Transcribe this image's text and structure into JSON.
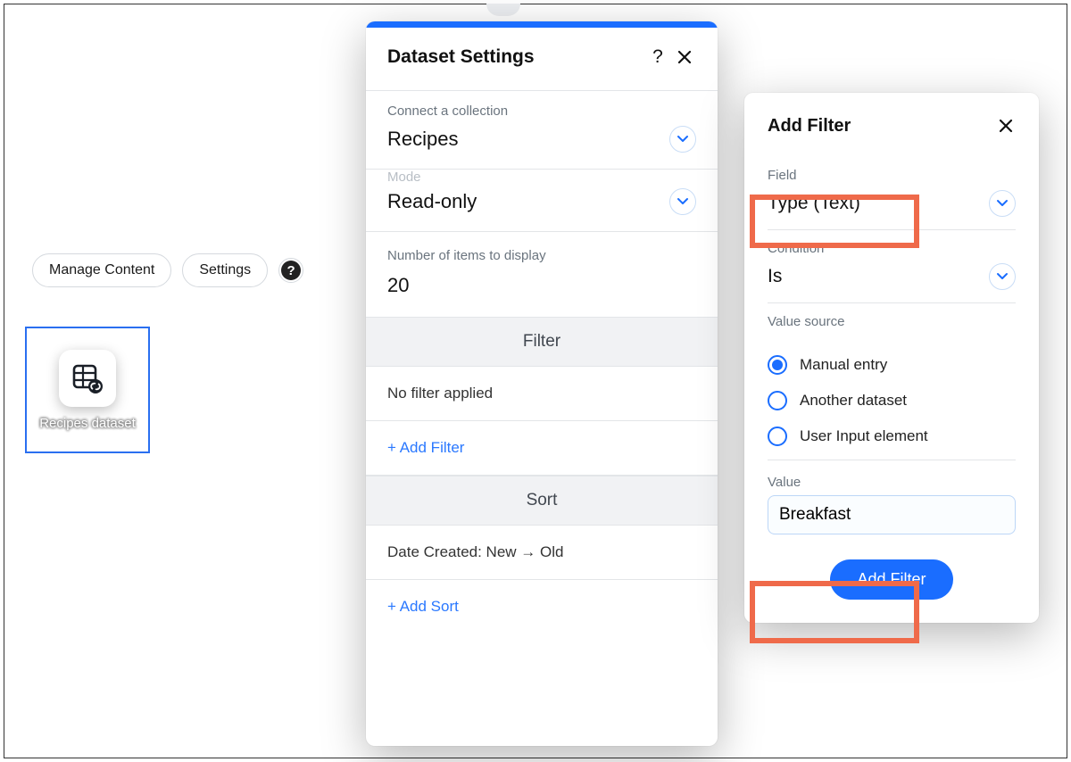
{
  "toolbar": {
    "manage_content": "Manage Content",
    "settings": "Settings"
  },
  "dataset_node": {
    "label": "Recipes dataset"
  },
  "settings_panel": {
    "title": "Dataset Settings",
    "connect_collection": {
      "label": "Connect a collection",
      "value": "Recipes"
    },
    "mode": {
      "label_cut": "Mode",
      "value": "Read-only"
    },
    "num_items": {
      "label": "Number of items to display",
      "value": "20"
    },
    "filter": {
      "header": "Filter",
      "none": "No filter applied",
      "add": "+ Add Filter"
    },
    "sort": {
      "header": "Sort",
      "row": "Date Created: New → Old",
      "add": "+ Add Sort"
    }
  },
  "add_filter_panel": {
    "title": "Add Filter",
    "field": {
      "label": "Field",
      "value": "Type (Text)"
    },
    "condition": {
      "label": "Condition",
      "value": "Is"
    },
    "value_source": {
      "label": "Value source",
      "options": [
        "Manual entry",
        "Another dataset",
        "User Input element"
      ],
      "selected_index": 0
    },
    "value": {
      "label": "Value",
      "input": "Breakfast"
    },
    "submit": "Add Filter"
  }
}
